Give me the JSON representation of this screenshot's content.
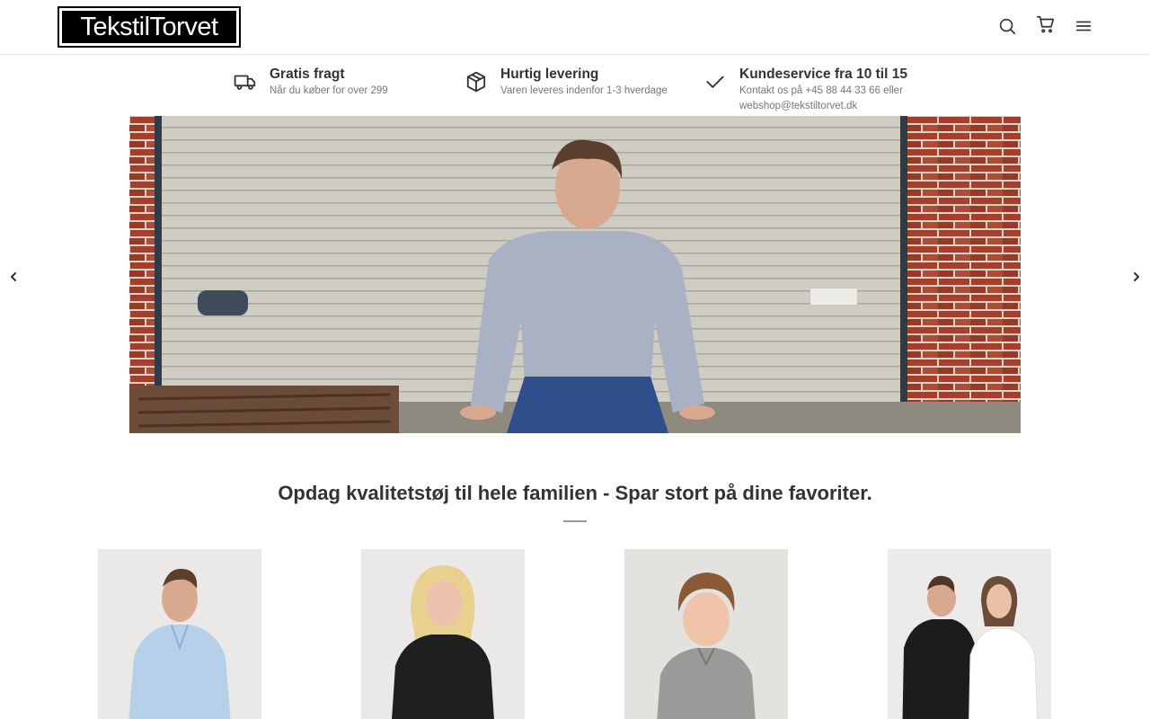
{
  "header": {
    "logo_text": "TekstilTorvet",
    "icons": [
      "search-icon",
      "cart-icon",
      "menu-icon"
    ]
  },
  "usps": [
    {
      "icon": "truck-icon",
      "title": "Gratis fragt",
      "subtitle": "Når du køber for over 299"
    },
    {
      "icon": "package-icon",
      "title": "Hurtig levering",
      "subtitle": "Varen leveres indenfor 1-3 hverdage"
    },
    {
      "icon": "check-icon",
      "title": "Kundeservice fra 10 til 15",
      "subtitle": "Kontakt os på +45 88 44 33 66 eller webshop@tekstiltorvet.dk"
    }
  ],
  "hero": {
    "image": "man-sitting-in-grey-sweatshirt-by-garage-door",
    "prev_icon": "chevron-left-icon",
    "next_icon": "chevron-right-icon"
  },
  "section": {
    "headline": "Opdag kvalitetstøj til hele familien - Spar stort på dine favoriter."
  },
  "products": [
    {
      "image": "man-in-light-blue-shirt"
    },
    {
      "image": "woman-in-black-polo"
    },
    {
      "image": "boy-in-grey-polo"
    },
    {
      "image": "couple-in-sweatshirts"
    }
  ],
  "colors": {
    "text": "#333333",
    "muted": "#777777",
    "brick": "#9b3b2a",
    "garage": "#c9c6bd",
    "sweatshirt": "#a9b2c4"
  }
}
